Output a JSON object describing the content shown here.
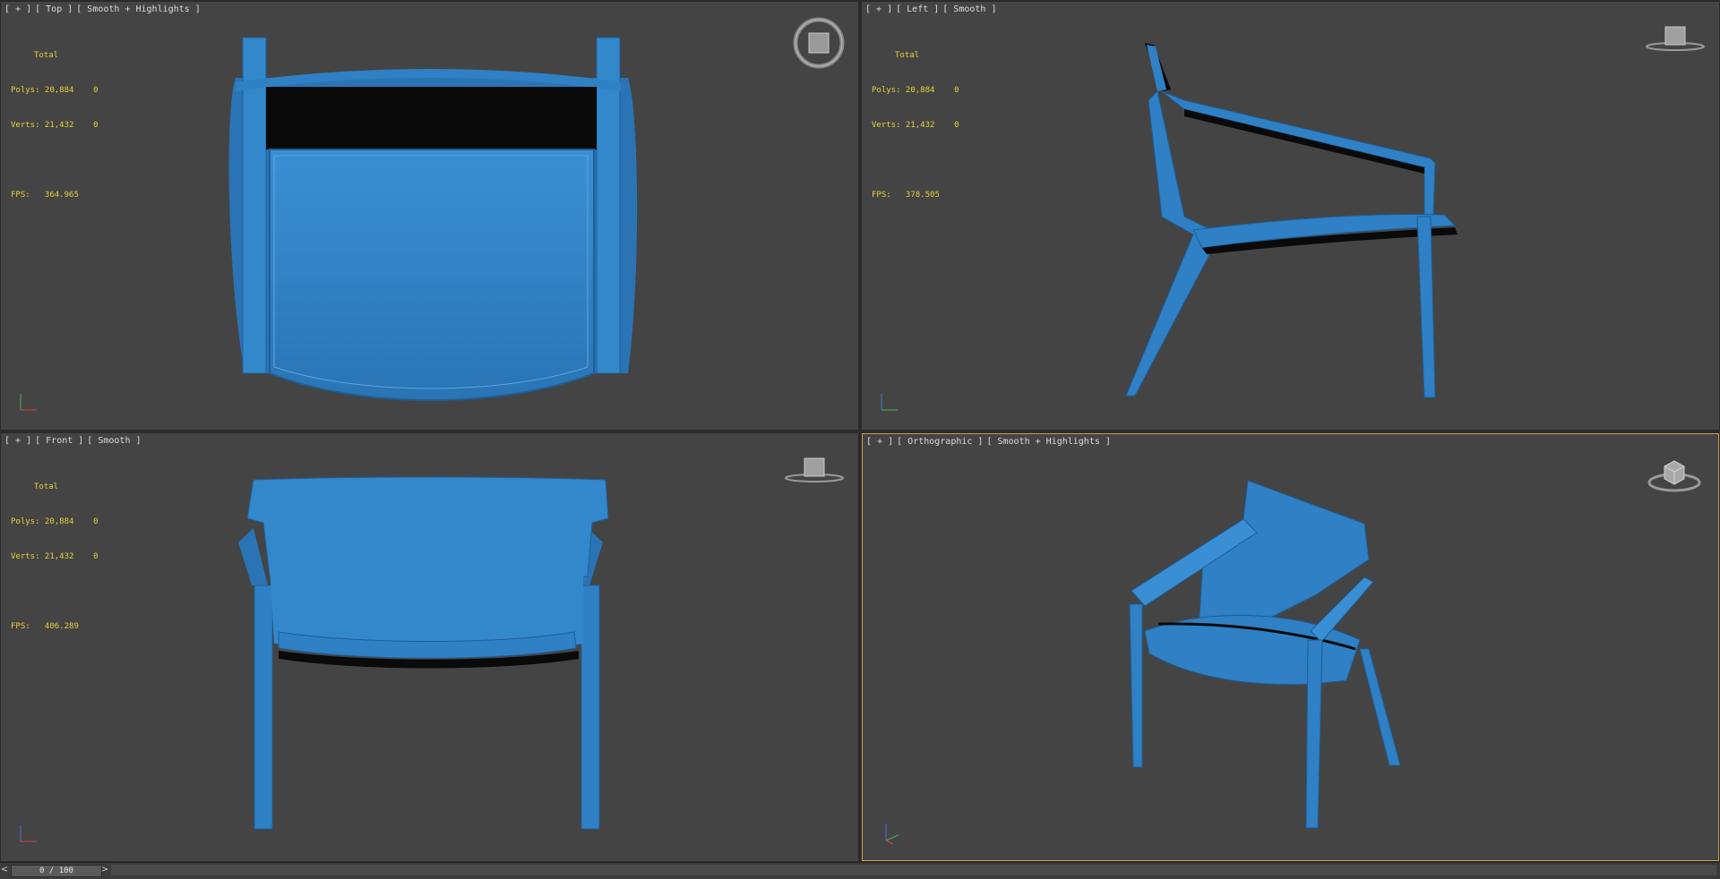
{
  "viewports": {
    "top": {
      "label": [
        "[ + ]",
        "[ Top ]",
        "[ Smooth + Highlights ]"
      ],
      "stats": {
        "total": "Total",
        "polys": "Polys: 20,884    0",
        "verts": "Verts: 21,432    0",
        "fps": "FPS:   364.965"
      },
      "cube_face": "TOP"
    },
    "left": {
      "label": [
        "[ + ]",
        "[ Left ]",
        "[ Smooth ]"
      ],
      "stats": {
        "total": "Total",
        "polys": "Polys: 20,884    0",
        "verts": "Verts: 21,432    0",
        "fps": "FPS:   378.505"
      },
      "cube_face": "LEFT"
    },
    "front": {
      "label": [
        "[ + ]",
        "[ Front ]",
        "[ Smooth ]"
      ],
      "stats": {
        "total": "Total",
        "polys": "Polys: 20,884    0",
        "verts": "Verts: 21,432    0",
        "fps": "FPS:   406.289"
      },
      "cube_face": "FRONT"
    },
    "perspective": {
      "label": [
        "[ + ]",
        "[ Orthographic ]",
        "[ Smooth + Highlights ]"
      ],
      "stats": {},
      "cube_face": ""
    }
  },
  "timeline": {
    "prev": "<",
    "next": ">",
    "frame": "0 / 100"
  },
  "colors": {
    "model": "#2f80c4",
    "model_dark": "#1e5e95",
    "active_border": "#c8a050",
    "stats": "#e8d23a"
  }
}
